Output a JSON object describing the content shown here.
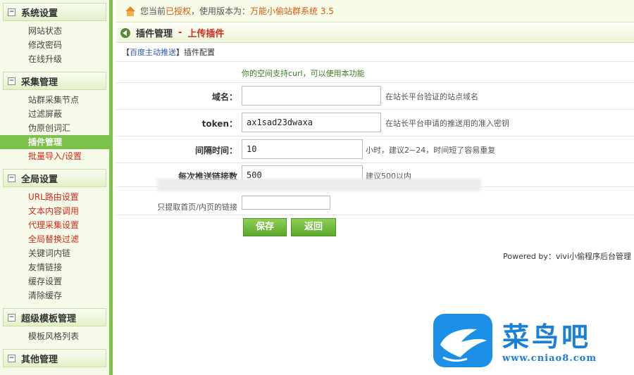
{
  "sidebar": {
    "groups": [
      {
        "title": "系统设置",
        "items": [
          "网站状态",
          "修改密码",
          "在线升级"
        ]
      },
      {
        "title": "采集管理",
        "items": [
          "站群采集节点",
          "过滤屏蔽",
          "伪原创词汇",
          "插件管理",
          "批量导入/设置"
        ]
      },
      {
        "title": "全局设置",
        "items": [
          "URL路由设置",
          "文本内容调用",
          "代理采集设置",
          "全局替换过滤",
          "关键词内链",
          "友情链接",
          "缓存设置",
          "清除缓存"
        ]
      },
      {
        "title": "超级模板管理",
        "items": [
          "模板风格列表"
        ]
      },
      {
        "title": "其他管理",
        "items": []
      }
    ],
    "toggle_symbol": "−"
  },
  "topbar": {
    "prefix": "您当前",
    "auth": "已授权",
    "mid": "，使用版本为：",
    "version": "万能小偷站群系统 3.5"
  },
  "title": {
    "main": "插件管理",
    "sep": "-",
    "sub": "上传插件"
  },
  "crumbs": {
    "open": "【",
    "link": "百度主动推送",
    "close": "】",
    "tail": "插件配置"
  },
  "form": {
    "support_msg": "你的空间支持curl，可以使用本功能",
    "domain_label": "域名：",
    "domain_value": "",
    "domain_hint": "在站长平台验证的站点域名",
    "token_label": "token：",
    "token_value": "ax1sad23dwaxa",
    "token_hint": "在站长平台申请的推送用的准入密钥",
    "interval_label": "间隔时间：",
    "interval_value": "10",
    "interval_hint": "小时，建议2~24，时间短了容易重复",
    "count_label": "每次推送链接数",
    "count_value": "500",
    "count_hint": "建议500以内",
    "scope_label": "只提取首页/内页的链接",
    "save_label": "保存",
    "back_label": "返回"
  },
  "footer": {
    "powered": "Powered by：vivi小偷程序后台管理"
  },
  "watermark": {
    "cn": "菜鸟吧",
    "url": "www.cniao8.com"
  },
  "colors": {
    "accent_green": "#7cc24a",
    "link_red": "#d02a1e",
    "link_blue": "#2a58b3",
    "watermark_blue": "#1a7fd6"
  }
}
